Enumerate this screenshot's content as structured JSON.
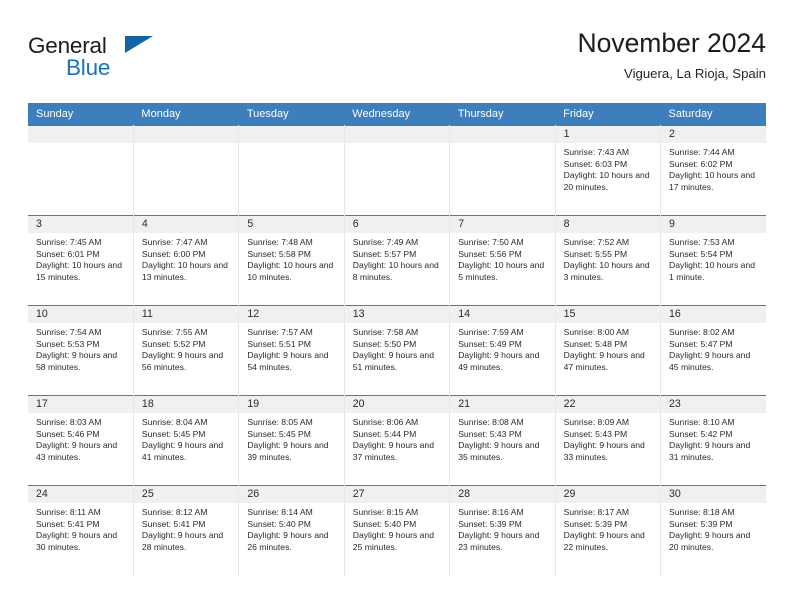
{
  "brand": {
    "name_part1": "General",
    "name_part2": "Blue",
    "triangle_color": "#1464a5",
    "blue_color": "#1873bd"
  },
  "header": {
    "title": "November 2024",
    "subtitle": "Viguera, La Rioja, Spain"
  },
  "theme": {
    "header_blue": "#3d7ebc",
    "daynum_bg": "#f0f0f0",
    "text": "#2b2b2b"
  },
  "calendar": {
    "weekday_headers": [
      "Sunday",
      "Monday",
      "Tuesday",
      "Wednesday",
      "Thursday",
      "Friday",
      "Saturday"
    ],
    "labels": {
      "sunrise": "Sunrise:",
      "sunset": "Sunset:",
      "daylight": "Daylight:"
    },
    "weeks": [
      [
        {
          "day": "",
          "empty": true
        },
        {
          "day": "",
          "empty": true
        },
        {
          "day": "",
          "empty": true
        },
        {
          "day": "",
          "empty": true
        },
        {
          "day": "",
          "empty": true
        },
        {
          "day": "1",
          "sunrise": "Sunrise: 7:43 AM",
          "sunset": "Sunset: 6:03 PM",
          "daylight": "Daylight: 10 hours and 20 minutes."
        },
        {
          "day": "2",
          "sunrise": "Sunrise: 7:44 AM",
          "sunset": "Sunset: 6:02 PM",
          "daylight": "Daylight: 10 hours and 17 minutes."
        }
      ],
      [
        {
          "day": "3",
          "sunrise": "Sunrise: 7:45 AM",
          "sunset": "Sunset: 6:01 PM",
          "daylight": "Daylight: 10 hours and 15 minutes."
        },
        {
          "day": "4",
          "sunrise": "Sunrise: 7:47 AM",
          "sunset": "Sunset: 6:00 PM",
          "daylight": "Daylight: 10 hours and 13 minutes."
        },
        {
          "day": "5",
          "sunrise": "Sunrise: 7:48 AM",
          "sunset": "Sunset: 5:58 PM",
          "daylight": "Daylight: 10 hours and 10 minutes."
        },
        {
          "day": "6",
          "sunrise": "Sunrise: 7:49 AM",
          "sunset": "Sunset: 5:57 PM",
          "daylight": "Daylight: 10 hours and 8 minutes."
        },
        {
          "day": "7",
          "sunrise": "Sunrise: 7:50 AM",
          "sunset": "Sunset: 5:56 PM",
          "daylight": "Daylight: 10 hours and 5 minutes."
        },
        {
          "day": "8",
          "sunrise": "Sunrise: 7:52 AM",
          "sunset": "Sunset: 5:55 PM",
          "daylight": "Daylight: 10 hours and 3 minutes."
        },
        {
          "day": "9",
          "sunrise": "Sunrise: 7:53 AM",
          "sunset": "Sunset: 5:54 PM",
          "daylight": "Daylight: 10 hours and 1 minute."
        }
      ],
      [
        {
          "day": "10",
          "sunrise": "Sunrise: 7:54 AM",
          "sunset": "Sunset: 5:53 PM",
          "daylight": "Daylight: 9 hours and 58 minutes."
        },
        {
          "day": "11",
          "sunrise": "Sunrise: 7:55 AM",
          "sunset": "Sunset: 5:52 PM",
          "daylight": "Daylight: 9 hours and 56 minutes."
        },
        {
          "day": "12",
          "sunrise": "Sunrise: 7:57 AM",
          "sunset": "Sunset: 5:51 PM",
          "daylight": "Daylight: 9 hours and 54 minutes."
        },
        {
          "day": "13",
          "sunrise": "Sunrise: 7:58 AM",
          "sunset": "Sunset: 5:50 PM",
          "daylight": "Daylight: 9 hours and 51 minutes."
        },
        {
          "day": "14",
          "sunrise": "Sunrise: 7:59 AM",
          "sunset": "Sunset: 5:49 PM",
          "daylight": "Daylight: 9 hours and 49 minutes."
        },
        {
          "day": "15",
          "sunrise": "Sunrise: 8:00 AM",
          "sunset": "Sunset: 5:48 PM",
          "daylight": "Daylight: 9 hours and 47 minutes."
        },
        {
          "day": "16",
          "sunrise": "Sunrise: 8:02 AM",
          "sunset": "Sunset: 5:47 PM",
          "daylight": "Daylight: 9 hours and 45 minutes."
        }
      ],
      [
        {
          "day": "17",
          "sunrise": "Sunrise: 8:03 AM",
          "sunset": "Sunset: 5:46 PM",
          "daylight": "Daylight: 9 hours and 43 minutes."
        },
        {
          "day": "18",
          "sunrise": "Sunrise: 8:04 AM",
          "sunset": "Sunset: 5:45 PM",
          "daylight": "Daylight: 9 hours and 41 minutes."
        },
        {
          "day": "19",
          "sunrise": "Sunrise: 8:05 AM",
          "sunset": "Sunset: 5:45 PM",
          "daylight": "Daylight: 9 hours and 39 minutes."
        },
        {
          "day": "20",
          "sunrise": "Sunrise: 8:06 AM",
          "sunset": "Sunset: 5:44 PM",
          "daylight": "Daylight: 9 hours and 37 minutes."
        },
        {
          "day": "21",
          "sunrise": "Sunrise: 8:08 AM",
          "sunset": "Sunset: 5:43 PM",
          "daylight": "Daylight: 9 hours and 35 minutes."
        },
        {
          "day": "22",
          "sunrise": "Sunrise: 8:09 AM",
          "sunset": "Sunset: 5:43 PM",
          "daylight": "Daylight: 9 hours and 33 minutes."
        },
        {
          "day": "23",
          "sunrise": "Sunrise: 8:10 AM",
          "sunset": "Sunset: 5:42 PM",
          "daylight": "Daylight: 9 hours and 31 minutes."
        }
      ],
      [
        {
          "day": "24",
          "sunrise": "Sunrise: 8:11 AM",
          "sunset": "Sunset: 5:41 PM",
          "daylight": "Daylight: 9 hours and 30 minutes."
        },
        {
          "day": "25",
          "sunrise": "Sunrise: 8:12 AM",
          "sunset": "Sunset: 5:41 PM",
          "daylight": "Daylight: 9 hours and 28 minutes."
        },
        {
          "day": "26",
          "sunrise": "Sunrise: 8:14 AM",
          "sunset": "Sunset: 5:40 PM",
          "daylight": "Daylight: 9 hours and 26 minutes."
        },
        {
          "day": "27",
          "sunrise": "Sunrise: 8:15 AM",
          "sunset": "Sunset: 5:40 PM",
          "daylight": "Daylight: 9 hours and 25 minutes."
        },
        {
          "day": "28",
          "sunrise": "Sunrise: 8:16 AM",
          "sunset": "Sunset: 5:39 PM",
          "daylight": "Daylight: 9 hours and 23 minutes."
        },
        {
          "day": "29",
          "sunrise": "Sunrise: 8:17 AM",
          "sunset": "Sunset: 5:39 PM",
          "daylight": "Daylight: 9 hours and 22 minutes."
        },
        {
          "day": "30",
          "sunrise": "Sunrise: 8:18 AM",
          "sunset": "Sunset: 5:39 PM",
          "daylight": "Daylight: 9 hours and 20 minutes."
        }
      ]
    ]
  }
}
